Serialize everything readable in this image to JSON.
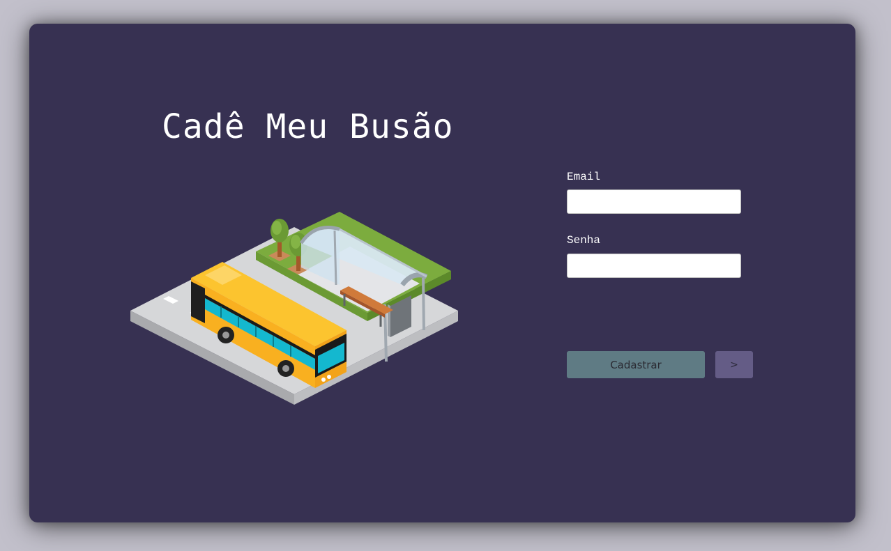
{
  "app": {
    "title": "Cadê Meu Busão"
  },
  "illustration": {
    "subject": "bus-stop-illustration"
  },
  "form": {
    "email_label": "Email",
    "email_value": "",
    "password_label": "Senha",
    "password_value": "",
    "register_label": "Cadastrar",
    "next_label": ">"
  },
  "colors": {
    "background": "#c2c0cb",
    "card": "#373152",
    "register_button": "#5f7b84",
    "next_button": "#645c86",
    "bus_yellow": "#fbbd2b",
    "bus_window": "#14b8cf",
    "grass": "#7cac3e"
  }
}
